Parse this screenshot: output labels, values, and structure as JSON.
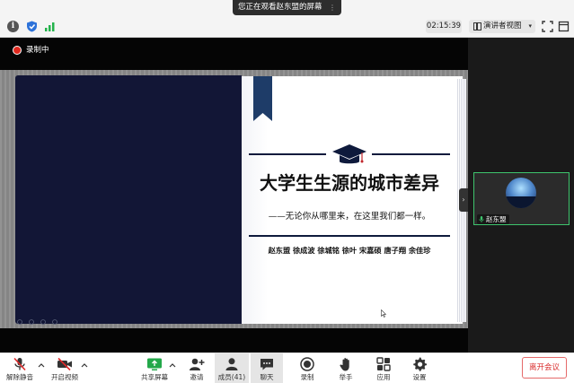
{
  "share_banner": {
    "text": "您正在观看赵东盟的屏幕"
  },
  "titlebar": {
    "timer": "02:15:39",
    "view_label": "演讲者视图"
  },
  "recording": {
    "label": "录制中"
  },
  "slide": {
    "title": "大学生生源的城市差异",
    "subtitle": "——无论你从哪里来，在这里我们都一样。",
    "authors": "赵东盟 徐成波 徐城铭 徐叶 宋嘉硕 唐子翔 余佳珍"
  },
  "participant_tile": {
    "name": "赵东盟"
  },
  "toolbar": {
    "mute_label": "解除静音",
    "video_label": "开启视频",
    "share_label": "共享屏幕",
    "invite_label": "邀请",
    "members_label": "成员(41)",
    "chat_label": "聊天",
    "record_label": "录制",
    "raise_hand_label": "举手",
    "apps_label": "应用",
    "settings_label": "设置",
    "leave_label": "离开会议"
  },
  "colors": {
    "slide_navy": "#121636",
    "leave_red": "#d92c2c",
    "record_red": "#e0281e",
    "speaker_green": "#3ec46d"
  }
}
